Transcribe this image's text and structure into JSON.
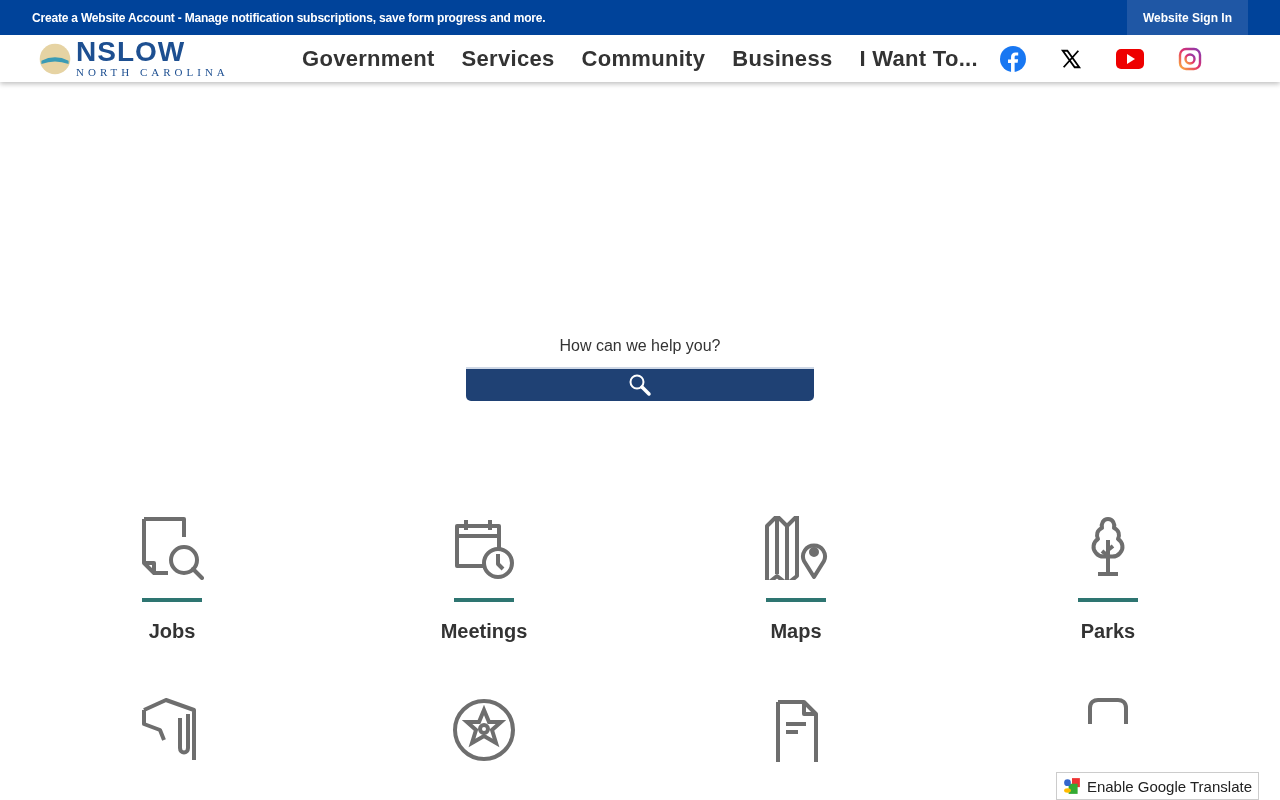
{
  "banner": {
    "text": "Create a Website Account - Manage notification subscriptions, save form progress and more.",
    "sign_in": "Website Sign In"
  },
  "logo": {
    "name": "NSLOW",
    "tagline": "NORTH CAROLINA"
  },
  "nav": [
    "Government",
    "Services",
    "Community",
    "Business",
    "I Want To..."
  ],
  "search": {
    "label": "How can we help you?"
  },
  "tiles": [
    {
      "label": "Jobs"
    },
    {
      "label": "Meetings"
    },
    {
      "label": "Maps"
    },
    {
      "label": "Parks"
    }
  ],
  "translate": {
    "label": "Enable Google Translate"
  }
}
